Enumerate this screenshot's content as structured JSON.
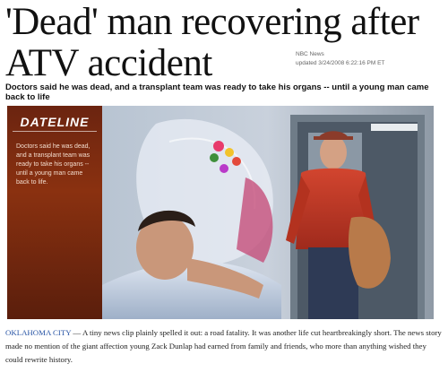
{
  "article": {
    "headline_line1": "'Dead' man recovering after",
    "headline_line2": "ATV accident",
    "source": "NBC News",
    "updated": "updated 3/24/2008 6:22:16 PM ET",
    "subhead": "Doctors said he was dead, and a transplant team was ready to take his organs -- until a young man came back to life",
    "sidebar_logo": "DATELINE",
    "sidebar_text": "Doctors said he was dead, and a transplant team was ready to take his organs -- until a young man came back to life.",
    "caption_location": "OKLAHOMA CITY",
    "caption_body": " — A tiny news clip plainly spelled it out: a road fatality. It was another life cut heartbreakingly short. The news story made no mention of the giant affection young Zack Dunlap had earned from family and friends, who more than anything wished they could rewrite history."
  }
}
